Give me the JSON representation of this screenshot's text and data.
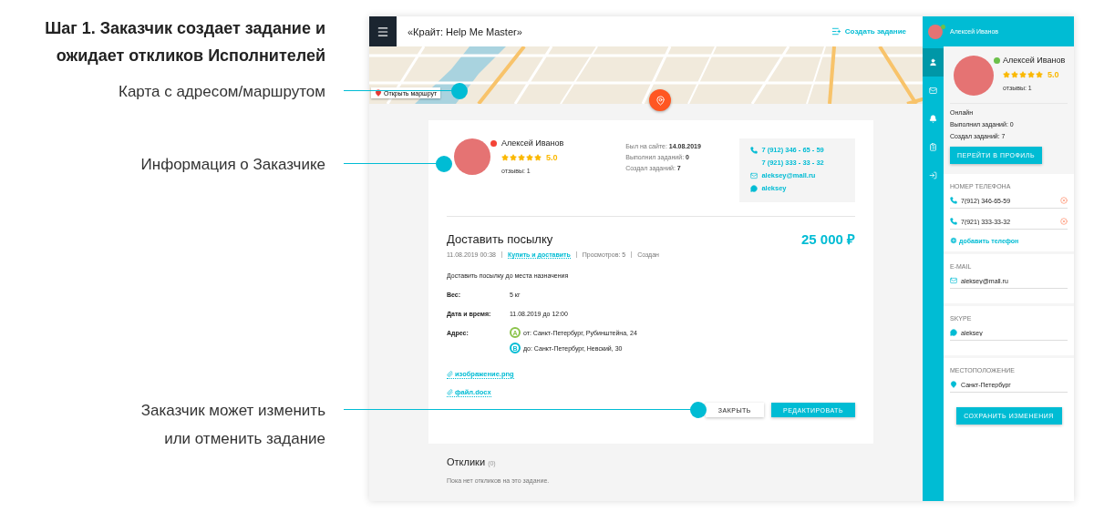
{
  "annotations": [
    {
      "kind": "heading",
      "text": "Шаг 1. Заказчик создает задание и ожидает откликов Исполнителей"
    },
    {
      "kind": "callout",
      "text": "Карта с адресом/маршрутом"
    },
    {
      "kind": "callout",
      "text": "Информация о Заказчике"
    },
    {
      "kind": "callout",
      "text": "Заказчик может изменить или отменить задание"
    }
  ],
  "header": {
    "title": "«Крайт: Help Me Master»",
    "create_button": "Создать задание"
  },
  "map": {
    "route_button": "Открыть маршрут"
  },
  "customer": {
    "name": "Алексей Иванов",
    "online": false,
    "stars": 5,
    "rating": "5.0",
    "reviews": "отзывы: 1",
    "stats": [
      {
        "label": "Был на сайте:",
        "value": "14.08.2019"
      },
      {
        "label": "Выполнил заданий:",
        "value": "0"
      },
      {
        "label": "Создал заданий:",
        "value": "7"
      }
    ],
    "phones": [
      "7 (912) 346 - 65 - 59",
      "7 (921) 333 - 33 - 32"
    ],
    "email": "aleksey@mall.ru",
    "skype": "aleksey"
  },
  "task": {
    "title": "Доставить посылку",
    "price": "25 000 ₽",
    "date": "11.08.2019 00:38",
    "category": "Купить и доставить",
    "views": "Просмотров: 5",
    "status": "Создан",
    "description": "Доставить посылку до места назначения",
    "details": [
      {
        "label": "Вес:",
        "value": "5 кг"
      },
      {
        "label": "Дата и время:",
        "value": "11.08.2019 до 12:00"
      }
    ],
    "address_label": "Адрес:",
    "points": [
      {
        "marker": "A",
        "text": "от: Санкт-Петербург, Рубинштейна, 24",
        "color": "#8bc34a"
      },
      {
        "marker": "B",
        "text": "до: Санкт-Петербург, Невский, 30",
        "color": "#00bcd4"
      }
    ],
    "attachments": [
      "изображение.png",
      "файл.docx"
    ],
    "close_button": "ЗАКРЫТЬ",
    "edit_button": "РЕДАКТИРОВАТЬ"
  },
  "responses": {
    "title": "Отклики",
    "count": "(0)",
    "empty": "Пока нет откликов на это задание."
  },
  "sidebar": {
    "user_name": "Алексей Иванов",
    "online": true,
    "rail": [
      {
        "selected": true
      },
      {
        "selected": false
      },
      {
        "selected": false
      },
      {
        "selected": false
      },
      {
        "selected": false
      }
    ],
    "profile": {
      "name": "Алексей Иванов",
      "online": true,
      "stars": 5,
      "rating": "5.0",
      "reviews": "отзывы: 1",
      "status": "Онлайн",
      "done": "Выполнил заданий: 0",
      "created": "Создал заданий: 7",
      "profile_button": "ПЕРЕЙТИ В ПРОФИЛЬ"
    },
    "phone_label": "НОМЕР ТЕЛЕФОНА",
    "phones": [
      "7(912) 346-65-59",
      "7(921) 333-33-32"
    ],
    "add_phone": "добавить телефон",
    "email_label": "E-MAIL",
    "email": "aleksey@mall.ru",
    "skype_label": "SKYPE",
    "skype": "aleksey",
    "location_label": "МЕСТОПОЛОЖЕНИЕ",
    "location": "Санкт-Петербург",
    "save_button": "СОХРАНИТЬ ИЗМЕНЕНИЯ"
  }
}
